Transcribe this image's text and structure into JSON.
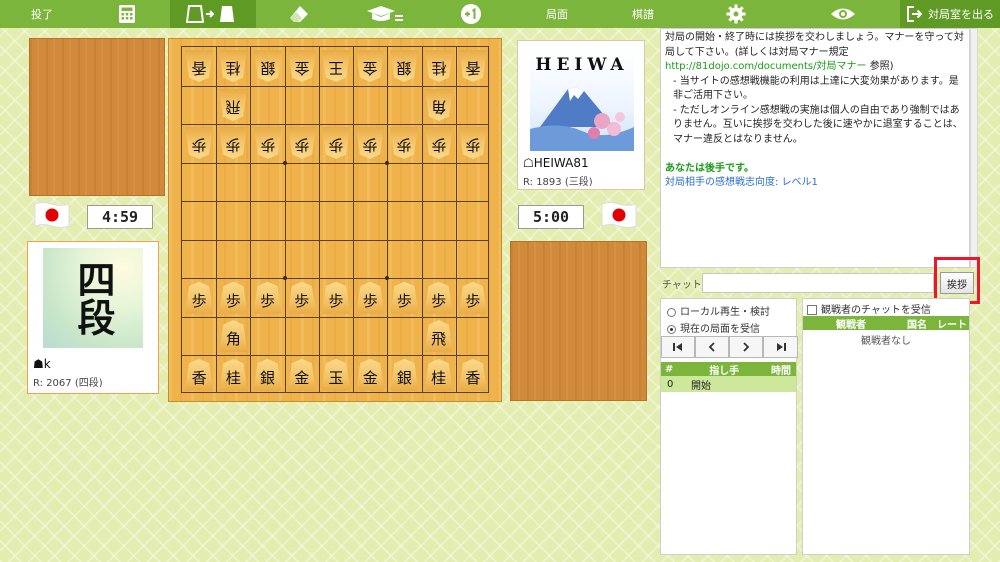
{
  "toolbar": {
    "resign": "投了",
    "position": "局面",
    "kifu": "棋譜",
    "leave": "対局室を出る"
  },
  "board": {
    "rows": [
      [
        {
          "p": "香",
          "o": "g"
        },
        {
          "p": "桂",
          "o": "g"
        },
        {
          "p": "銀",
          "o": "g"
        },
        {
          "p": "金",
          "o": "g"
        },
        {
          "p": "王",
          "o": "g"
        },
        {
          "p": "金",
          "o": "g"
        },
        {
          "p": "銀",
          "o": "g"
        },
        {
          "p": "桂",
          "o": "g"
        },
        {
          "p": "香",
          "o": "g"
        }
      ],
      [
        null,
        {
          "p": "飛",
          "o": "g"
        },
        null,
        null,
        null,
        null,
        null,
        {
          "p": "角",
          "o": "g"
        },
        null
      ],
      [
        {
          "p": "歩",
          "o": "g"
        },
        {
          "p": "歩",
          "o": "g"
        },
        {
          "p": "歩",
          "o": "g"
        },
        {
          "p": "歩",
          "o": "g"
        },
        {
          "p": "歩",
          "o": "g"
        },
        {
          "p": "歩",
          "o": "g"
        },
        {
          "p": "歩",
          "o": "g"
        },
        {
          "p": "歩",
          "o": "g"
        },
        {
          "p": "歩",
          "o": "g"
        }
      ],
      [
        null,
        null,
        null,
        null,
        null,
        null,
        null,
        null,
        null
      ],
      [
        null,
        null,
        null,
        null,
        null,
        null,
        null,
        null,
        null
      ],
      [
        null,
        null,
        null,
        null,
        null,
        null,
        null,
        null,
        null
      ],
      [
        {
          "p": "歩",
          "o": "s"
        },
        {
          "p": "歩",
          "o": "s"
        },
        {
          "p": "歩",
          "o": "s"
        },
        {
          "p": "歩",
          "o": "s"
        },
        {
          "p": "歩",
          "o": "s"
        },
        {
          "p": "歩",
          "o": "s"
        },
        {
          "p": "歩",
          "o": "s"
        },
        {
          "p": "歩",
          "o": "s"
        },
        {
          "p": "歩",
          "o": "s"
        }
      ],
      [
        null,
        {
          "p": "角",
          "o": "s"
        },
        null,
        null,
        null,
        null,
        null,
        {
          "p": "飛",
          "o": "s"
        },
        null
      ],
      [
        {
          "p": "香",
          "o": "s"
        },
        {
          "p": "桂",
          "o": "s"
        },
        {
          "p": "銀",
          "o": "s"
        },
        {
          "p": "金",
          "o": "s"
        },
        {
          "p": "玉",
          "o": "s"
        },
        {
          "p": "金",
          "o": "s"
        },
        {
          "p": "銀",
          "o": "s"
        },
        {
          "p": "桂",
          "o": "s"
        },
        {
          "p": "香",
          "o": "s"
        }
      ]
    ]
  },
  "self": {
    "clock": "4:59",
    "avatar_text": "四段",
    "name": "☗k",
    "rating": "R: 2067 (四段)"
  },
  "opponent": {
    "clock": "5:00",
    "avatar_text": "HEIWA",
    "name": "☖HEIWA81",
    "rating": "R: 1893 (三段)"
  },
  "chat": {
    "line1": "対局の開始・終了時には挨拶を交わしましょう。マナーを守って対局して下さい。(詳しくは対局マナー規定",
    "link": "http://81dojo.com/documents/対局マナー",
    "link_suffix": " 参照)",
    "line2": "- 当サイトの感想戦機能の利用は上達に大変効果があります。是非ご活用下さい。",
    "line3": "- ただしオンライン感想戦の実施は個人の自由であり強制ではありません。互いに挨拶を交わした後に速やかに退室することは、マナー違反とはなりません。",
    "gote_notice": "あなたは後手です。",
    "review_pref": "対局相手の感想戦志向度: レベル1",
    "input_label": "チャット",
    "greet_button": "挨拶"
  },
  "replay": {
    "local_label": "ローカル再生・検討",
    "receive_label": "現在の局面を受信",
    "col_num": "#",
    "col_move": "指し手",
    "col_time": "時間",
    "row_num": "0",
    "row_move": "開始"
  },
  "spectators": {
    "checkbox_label": "観戦者のチャットを受信",
    "col_name": "観戦者",
    "col_country": "国名",
    "col_rate": "レート",
    "empty": "観戦者なし"
  }
}
